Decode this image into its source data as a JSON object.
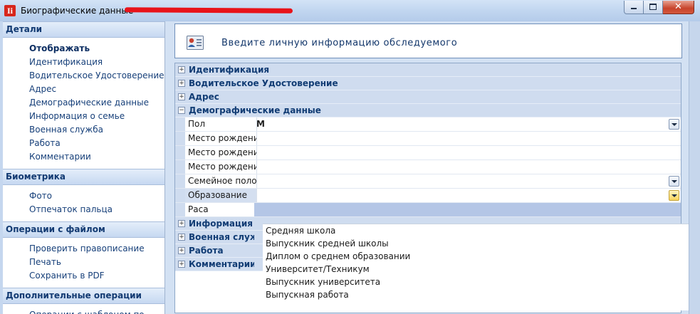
{
  "window": {
    "app_icon_letter": "Ii",
    "title": "Биографические данные -",
    "buttons": {
      "minimize": "",
      "maximize": "",
      "close": "✕"
    }
  },
  "sidebar": {
    "sections": [
      {
        "title": "Детали",
        "items": [
          {
            "label": "Отображать",
            "active": true
          },
          {
            "label": "Идентификация"
          },
          {
            "label": "Водительское Удостоверение"
          },
          {
            "label": "Адрес"
          },
          {
            "label": "Демографические данные"
          },
          {
            "label": "Информация о семье"
          },
          {
            "label": "Военная служба"
          },
          {
            "label": "Работа"
          },
          {
            "label": "Комментарии"
          }
        ]
      },
      {
        "title": "Биометрика",
        "items": [
          {
            "label": "Фото"
          },
          {
            "label": "Отпечаток пальца"
          }
        ]
      },
      {
        "title": "Операции с файлом",
        "items": [
          {
            "label": "Проверить правописание"
          },
          {
            "label": "Печать"
          },
          {
            "label": "Сохранить в PDF"
          }
        ]
      },
      {
        "title": "Дополнительные операции",
        "items": [
          {
            "label": "Операции с шаблоном по"
          }
        ]
      }
    ]
  },
  "header": {
    "icon": "person-card-icon",
    "text": "Введите личную информацию обследуемого"
  },
  "grid": {
    "categories_top": [
      {
        "label": "Идентификация",
        "expander": "+"
      },
      {
        "label": "Водительское Удостоверение",
        "expander": "+"
      },
      {
        "label": "Адрес",
        "expander": "+"
      },
      {
        "label": "Демографические данные",
        "expander": "−"
      }
    ],
    "rows": [
      {
        "name": "Пол",
        "value": "М"
      },
      {
        "name": "Место рождения",
        "value": ""
      },
      {
        "name": "Место рождения",
        "value": ""
      },
      {
        "name": "Место рождения",
        "value": ""
      },
      {
        "name": "Семейное положение",
        "value": ""
      },
      {
        "name": "Образование",
        "value": ""
      },
      {
        "name": "Раса",
        "value": ""
      }
    ],
    "categories_bottom": [
      {
        "label": "Информация о семье",
        "expander": "+"
      },
      {
        "label": "Военная служба",
        "expander": "+"
      },
      {
        "label": "Работа",
        "expander": "+"
      },
      {
        "label": "Комментарии",
        "expander": "+"
      }
    ]
  },
  "dropdown": {
    "options": [
      "Средняя школа",
      "Выпускник средней школы",
      "Диплом о среднем образовании",
      "Университет/Техникум",
      "Выпускник университета",
      "Выпускная работа"
    ]
  }
}
